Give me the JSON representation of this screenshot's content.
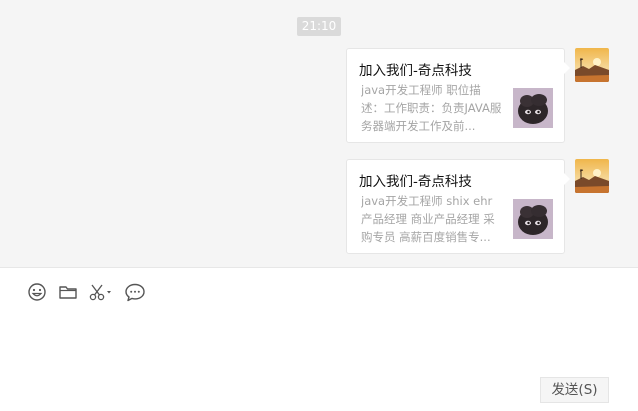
{
  "chat": {
    "timestamp": "21:10",
    "messages": [
      {
        "title": "加入我们-奇点科技",
        "description": "java开发工程师 职位描述：工作职责：负责JAVA服务器端开发工作及前...",
        "thumbnail_icon": "dark-fluffy-creature-thumbnail",
        "avatar_icon": "sunset-landscape-avatar"
      },
      {
        "title": "加入我们-奇点科技",
        "description": "java开发工程师 shix ehr 产品经理 商业产品经理 采购专员 高薪百度销售专...",
        "thumbnail_icon": "dark-fluffy-creature-thumbnail",
        "avatar_icon": "sunset-landscape-avatar"
      }
    ]
  },
  "toolbar": {
    "icons": [
      "emoji-icon",
      "folder-icon",
      "scissors-icon",
      "chat-bubble-icon"
    ]
  },
  "input": {
    "value": ""
  },
  "send_button": {
    "label": "发送(S)"
  },
  "colors": {
    "chat_background": "#f5f5f5",
    "card_background": "#ffffff",
    "timestamp_background": "#dadada",
    "title_text": "#111111",
    "description_text": "#a5a5a5"
  }
}
